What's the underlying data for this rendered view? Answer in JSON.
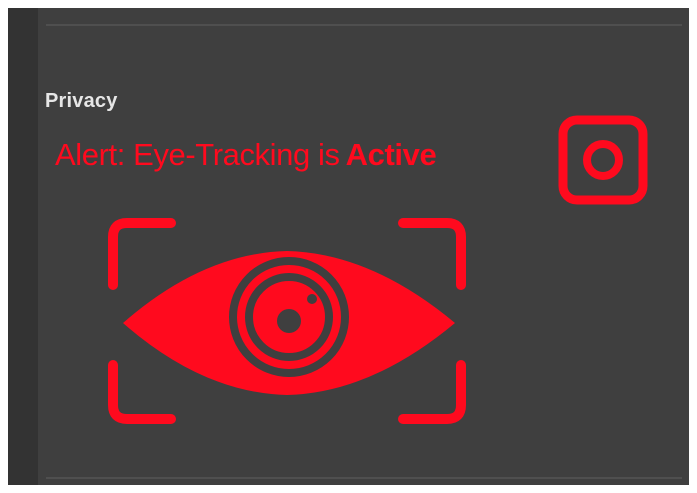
{
  "section": {
    "title": "Privacy"
  },
  "alert": {
    "prefix": "Alert: Eye-Tracking is",
    "status": "Active",
    "color": "#ff0a1e"
  },
  "controls": {
    "record_icon": "record-square-icon"
  },
  "illustration": {
    "icon": "eye-tracking-icon"
  },
  "theme": {
    "panel_bg": "#3f3f3f",
    "accent": "#ff0a1e",
    "text": "#e6e6e6"
  }
}
